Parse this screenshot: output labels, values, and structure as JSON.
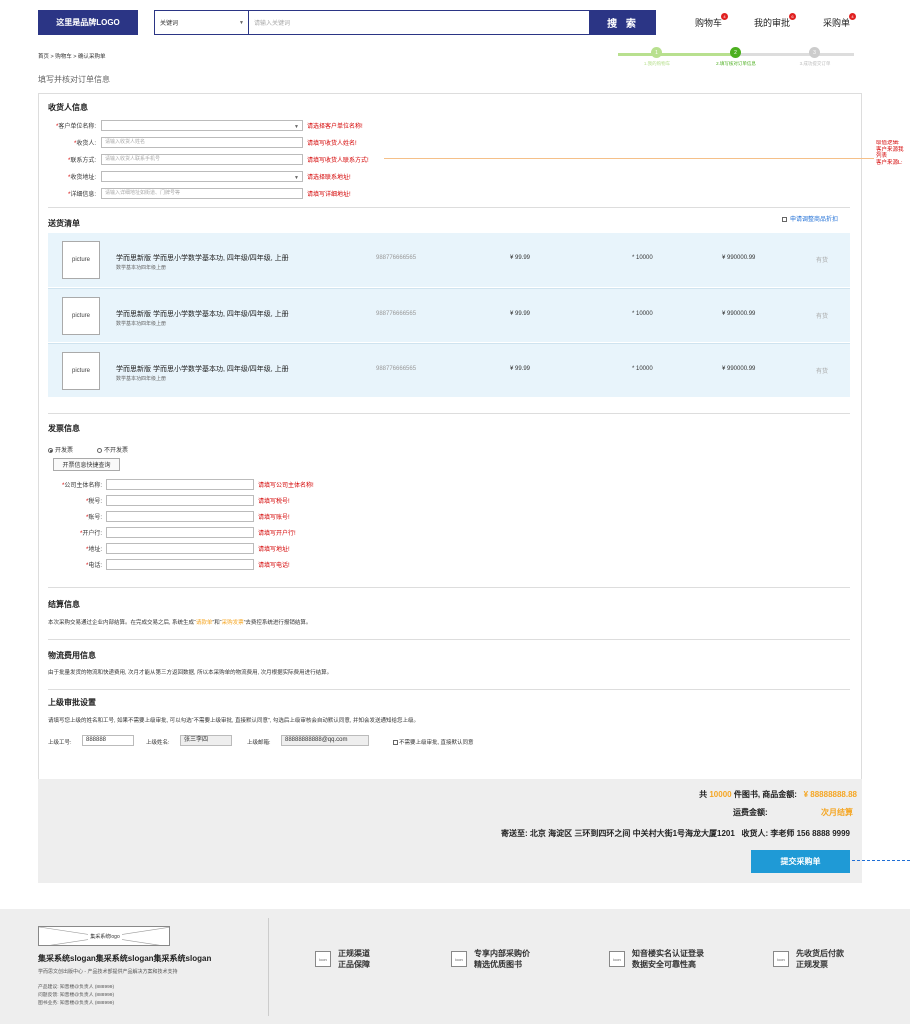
{
  "header": {
    "logo": "这里是品牌LOGO",
    "search_select": "关键词",
    "search_placeholder": "请输入关键词",
    "search_button": "搜 索",
    "nav": [
      {
        "label": "购物车",
        "badge": "4"
      },
      {
        "label": "我的审批",
        "badge": "6"
      },
      {
        "label": "采购单",
        "badge": "4"
      }
    ]
  },
  "breadcrumb": "首页 > 购物车 > 确认采购单",
  "subtitle": "填写并核对订单信息",
  "steps": [
    {
      "num": "1",
      "label": "1.我的购物车"
    },
    {
      "num": "2",
      "label": "2.填写核对订单信息"
    },
    {
      "num": "3",
      "label": "3.成功提交订单"
    }
  ],
  "consignee": {
    "title": "收货人信息",
    "fields": [
      {
        "label": "客户单位名称:",
        "placeholder": "",
        "error": "请选择客户单位名称!",
        "select": true
      },
      {
        "label": "收货人:",
        "placeholder": "请输入收货人姓名",
        "error": "请填写收货人姓名!",
        "select": false
      },
      {
        "label": "联系方式:",
        "placeholder": "请输入收货人联系手机号",
        "error": "请填写收货人联系方式!",
        "select": false
      },
      {
        "label": "收货地址:",
        "placeholder": "",
        "error": "请选择联系地址!",
        "select": true
      },
      {
        "label": "详细信息:",
        "placeholder": "请输入详细地址如街道、门牌号等",
        "error": "请填写详细地址!",
        "select": false
      }
    ],
    "side_note": [
      "取值逻辑:",
      "客户来源我",
      "列表",
      "客户来源L:"
    ]
  },
  "delivery": {
    "title": "送货清单",
    "adjust_link": "申请调整商品折扣",
    "items": [
      {
        "pic": "picture",
        "title": "学而思新版 学而思小学数学基本功, 四年级/四年级, 上册",
        "sub": "数学基本功四年级上册",
        "code": "988776666565",
        "price": "¥ 99.99",
        "qty": "* 10000",
        "total": "¥ 990000.99",
        "stock": "有货"
      },
      {
        "pic": "picture",
        "title": "学而思新版 学而思小学数学基本功, 四年级/四年级, 上册",
        "sub": "数学基本功四年级上册",
        "code": "988776666565",
        "price": "¥ 99.99",
        "qty": "* 10000",
        "total": "¥ 990000.99",
        "stock": "有货"
      },
      {
        "pic": "picture",
        "title": "学而思新版 学而思小学数学基本功, 四年级/四年级, 上册",
        "sub": "数学基本功四年级上册",
        "code": "988776666565",
        "price": "¥ 99.99",
        "qty": "* 10000",
        "total": "¥ 990000.99",
        "stock": "有货"
      }
    ]
  },
  "invoice": {
    "title": "发票信息",
    "radio_on": "开发票",
    "radio_off": "不开发票",
    "quick_btn": "开票信息快捷查询",
    "fields": [
      {
        "label": "公司主体名称:",
        "error": "请填写公司主体名称!"
      },
      {
        "label": "税号:",
        "error": "请填写税号!"
      },
      {
        "label": "账号:",
        "error": "请填写账号!"
      },
      {
        "label": "开户行:",
        "error": "请填写开户行!"
      },
      {
        "label": "地址:",
        "error": "请填写地址!"
      },
      {
        "label": "电话:",
        "error": "请填写电话!"
      }
    ]
  },
  "settlement": {
    "title": "结算信息",
    "text_a": "本次采购交易通过企业内部结算。在完成交易之后, 系统生成“",
    "link1": "请款单",
    "text_b": "”和“",
    "link2": "采购发票",
    "text_c": "”去费控系统进行报销结算。"
  },
  "logistics": {
    "title": "物流费用信息",
    "text": "由于批量发货的物流和快递费用, 次月才能从第三方返回数据, 所以本采购单的物流费用, 次月根据实际费用进行结算。"
  },
  "approval": {
    "title": "上级审批设置",
    "text": "请填写您上级的姓名和工号, 如果不需要上级审批, 可以勾选“不需要上级审批, 直接默认同意”, 勾选后上级审核会自动默认同意, 并知会发送通知给您上级。",
    "id_label": "上级工号:",
    "id_value": "888888",
    "name_label": "上级姓名:",
    "name_value": "张三李四",
    "email_label": "上级邮箱:",
    "email_value": "88888888888@qq.com",
    "skip_label": "不需要上级审批, 直接默认同意"
  },
  "summary": {
    "count_prefix": "共",
    "count": "10000",
    "count_suffix": "件图书, 商品金额:",
    "amount": "¥ 88888888.88",
    "shipping_label": "运费金额:",
    "shipping_value": "次月结算",
    "address": "寄送至: 北京 海淀区 三环到四环之间 中关村大街1号海龙大厦1201   收货人: 李老师 156 8888 9999",
    "submit": "提交采购单"
  },
  "footer": {
    "logo": "集采系统logo",
    "slogan": "集采系统slogan集采系统slogan集采系统slogan",
    "desc": "学而思文创出版中心 - 产品技术部提供产品解决方案和技术支持",
    "contacts": [
      "产品建议: 知音楼@负责人 (888999)",
      "问题反馈: 知音楼@负责人 (888999)",
      "图书业务: 知音楼@负责人 (888999)"
    ],
    "features": [
      {
        "icon": "icon",
        "line1": "正规渠道",
        "line2": "正品保障"
      },
      {
        "icon": "icon",
        "line1": "专享内部采购价",
        "line2": "精选优质图书"
      },
      {
        "icon": "icon",
        "line1": "知音楼实名认证登录",
        "line2": "数据安全可靠性高"
      },
      {
        "icon": "icon",
        "line1": "先收货后付款",
        "line2": "正规发票"
      }
    ]
  },
  "colors": {
    "brand": "#2b3585",
    "green": "#7ac943",
    "red": "#d40000",
    "orange": "#f5a623",
    "blue": "#1f9ad6"
  }
}
